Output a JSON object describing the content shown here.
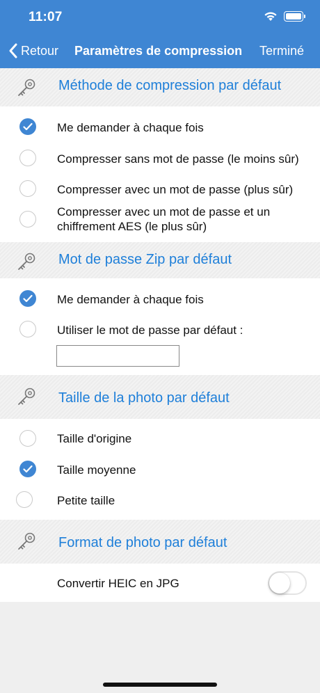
{
  "status_bar": {
    "time": "11:07"
  },
  "nav": {
    "back_label": "Retour",
    "title": "Paramètres de compression",
    "done_label": "Terminé"
  },
  "sections": {
    "compression_method": {
      "title": "Méthode de compression par défaut",
      "options": [
        {
          "label": "Me demander à chaque fois",
          "selected": true
        },
        {
          "label": "Compresser sans mot de passe (le moins sûr)",
          "selected": false
        },
        {
          "label": "Compresser avec un mot de passe (plus sûr)",
          "selected": false
        },
        {
          "label": "Compresser avec un mot de passe et un chiffrement AES (le plus sûr)",
          "selected": false
        }
      ]
    },
    "zip_password": {
      "title": "Mot de passe Zip par défaut",
      "options": [
        {
          "label": "Me demander à chaque fois",
          "selected": true
        },
        {
          "label": "Utiliser le mot de passe par défaut :",
          "selected": false
        }
      ],
      "password_value": ""
    },
    "photo_size": {
      "title": "Taille de la photo par défaut",
      "options": [
        {
          "label": "Taille d'origine",
          "selected": false
        },
        {
          "label": "Taille moyenne",
          "selected": true
        },
        {
          "label": "Petite taille",
          "selected": false
        }
      ]
    },
    "photo_format": {
      "title": "Format de photo par défaut",
      "convert_label": "Convertir HEIC en JPG",
      "convert_enabled": false
    }
  },
  "colors": {
    "accent": "#3f86d3",
    "section_title": "#1e7fd9"
  }
}
